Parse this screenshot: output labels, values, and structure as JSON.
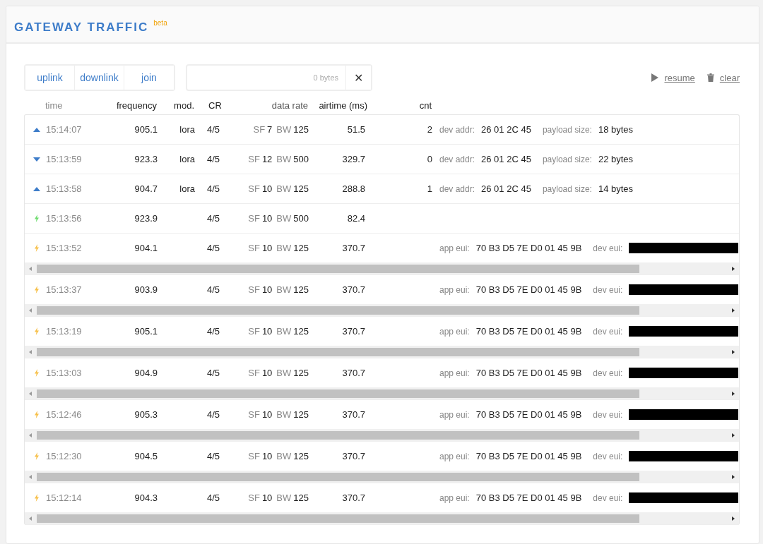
{
  "title": "GATEWAY TRAFFIC",
  "badge": "beta",
  "filters": [
    {
      "label": "uplink",
      "selected": false
    },
    {
      "label": "downlink",
      "selected": false
    },
    {
      "label": "join",
      "selected": false
    }
  ],
  "search": {
    "size": "0 bytes",
    "clear": "✕"
  },
  "actions": [
    {
      "kind": "play",
      "label": "resume"
    },
    {
      "kind": "trash",
      "label": "clear"
    }
  ],
  "columns": [
    "time",
    "frequency",
    "mod.",
    "CR",
    "data rate",
    "airtime (ms)",
    "cnt"
  ],
  "rows": [
    {
      "kind": "uplink",
      "time": "15:14:07",
      "frequency": "905.1",
      "mod": "lora",
      "cr": "4/5",
      "data_rate": [
        {
          "label": "SF",
          "value": "7"
        },
        {
          "label": "BW",
          "value": "125"
        }
      ],
      "airtime": "51.5",
      "cnt": "2",
      "details": [
        {
          "label": "dev addr:",
          "value": "26 01 2C 45"
        },
        {
          "label": "payload size:",
          "value": "18 bytes"
        }
      ],
      "scrollbar": false
    },
    {
      "kind": "downlink",
      "time": "15:13:59",
      "frequency": "923.3",
      "mod": "lora",
      "cr": "4/5",
      "data_rate": [
        {
          "label": "SF",
          "value": "12"
        },
        {
          "label": "BW",
          "value": "500"
        }
      ],
      "airtime": "329.7",
      "cnt": "0",
      "details": [
        {
          "label": "dev addr:",
          "value": "26 01 2C 45"
        },
        {
          "label": "payload size:",
          "value": "22 bytes"
        }
      ],
      "scrollbar": false
    },
    {
      "kind": "uplink",
      "time": "15:13:58",
      "frequency": "904.7",
      "mod": "lora",
      "cr": "4/5",
      "data_rate": [
        {
          "label": "SF",
          "value": "10"
        },
        {
          "label": "BW",
          "value": "125"
        }
      ],
      "airtime": "288.8",
      "cnt": "1",
      "details": [
        {
          "label": "dev addr:",
          "value": "26 01 2C 45"
        },
        {
          "label": "payload size:",
          "value": "14 bytes"
        }
      ],
      "scrollbar": false
    },
    {
      "kind": "join-accept",
      "time": "15:13:56",
      "frequency": "923.9",
      "cr": "4/5",
      "data_rate": [
        {
          "label": "SF",
          "value": "10"
        },
        {
          "label": "BW",
          "value": "500"
        }
      ],
      "airtime": "82.4",
      "scrollbar": false
    },
    {
      "kind": "join-request",
      "time": "15:13:52",
      "frequency": "904.1",
      "cr": "4/5",
      "data_rate": [
        {
          "label": "SF",
          "value": "10"
        },
        {
          "label": "BW",
          "value": "125"
        }
      ],
      "airtime": "370.7",
      "details": [
        {
          "label": "app eui:",
          "value": "70 B3 D5 7E D0 01 45 9B"
        },
        {
          "label": "dev eui:",
          "redacted": true
        }
      ],
      "scrollbar": true
    },
    {
      "kind": "join-request",
      "time": "15:13:37",
      "frequency": "903.9",
      "cr": "4/5",
      "data_rate": [
        {
          "label": "SF",
          "value": "10"
        },
        {
          "label": "BW",
          "value": "125"
        }
      ],
      "airtime": "370.7",
      "details": [
        {
          "label": "app eui:",
          "value": "70 B3 D5 7E D0 01 45 9B"
        },
        {
          "label": "dev eui:",
          "redacted": true
        }
      ],
      "scrollbar": true
    },
    {
      "kind": "join-request",
      "time": "15:13:19",
      "frequency": "905.1",
      "cr": "4/5",
      "data_rate": [
        {
          "label": "SF",
          "value": "10"
        },
        {
          "label": "BW",
          "value": "125"
        }
      ],
      "airtime": "370.7",
      "details": [
        {
          "label": "app eui:",
          "value": "70 B3 D5 7E D0 01 45 9B"
        },
        {
          "label": "dev eui:",
          "redacted": true
        }
      ],
      "scrollbar": true
    },
    {
      "kind": "join-request",
      "time": "15:13:03",
      "frequency": "904.9",
      "cr": "4/5",
      "data_rate": [
        {
          "label": "SF",
          "value": "10"
        },
        {
          "label": "BW",
          "value": "125"
        }
      ],
      "airtime": "370.7",
      "details": [
        {
          "label": "app eui:",
          "value": "70 B3 D5 7E D0 01 45 9B"
        },
        {
          "label": "dev eui:",
          "redacted": true
        }
      ],
      "scrollbar": true
    },
    {
      "kind": "join-request",
      "time": "15:12:46",
      "frequency": "905.3",
      "cr": "4/5",
      "data_rate": [
        {
          "label": "SF",
          "value": "10"
        },
        {
          "label": "BW",
          "value": "125"
        }
      ],
      "airtime": "370.7",
      "details": [
        {
          "label": "app eui:",
          "value": "70 B3 D5 7E D0 01 45 9B"
        },
        {
          "label": "dev eui:",
          "redacted": true
        }
      ],
      "scrollbar": true
    },
    {
      "kind": "join-request",
      "time": "15:12:30",
      "frequency": "904.5",
      "cr": "4/5",
      "data_rate": [
        {
          "label": "SF",
          "value": "10"
        },
        {
          "label": "BW",
          "value": "125"
        }
      ],
      "airtime": "370.7",
      "details": [
        {
          "label": "app eui:",
          "value": "70 B3 D5 7E D0 01 45 9B"
        },
        {
          "label": "dev eui:",
          "redacted": true
        }
      ],
      "scrollbar": true
    },
    {
      "kind": "join-request",
      "time": "15:12:14",
      "frequency": "904.3",
      "cr": "4/5",
      "data_rate": [
        {
          "label": "SF",
          "value": "10"
        },
        {
          "label": "BW",
          "value": "125"
        }
      ],
      "airtime": "370.7",
      "details": [
        {
          "label": "app eui:",
          "value": "70 B3 D5 7E D0 01 45 9B"
        },
        {
          "label": "dev eui:",
          "redacted": true
        }
      ],
      "scrollbar": true
    }
  ]
}
